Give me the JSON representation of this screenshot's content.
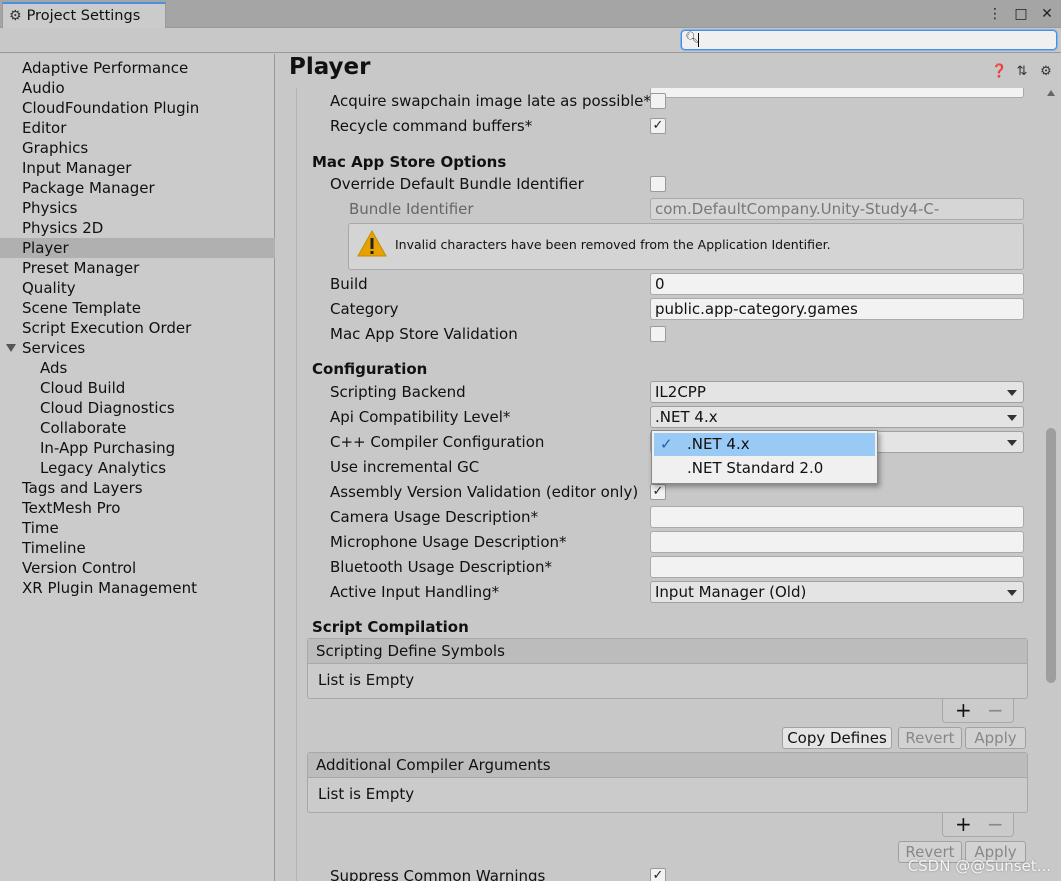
{
  "window": {
    "tab_title": "Project Settings",
    "controls": [
      "⋮",
      "□",
      "✕"
    ]
  },
  "search": {
    "placeholder": "",
    "value": ""
  },
  "sidebar": {
    "items": [
      {
        "label": "Adaptive Performance"
      },
      {
        "label": "Audio"
      },
      {
        "label": "CloudFoundation Plugin"
      },
      {
        "label": "Editor"
      },
      {
        "label": "Graphics"
      },
      {
        "label": "Input Manager"
      },
      {
        "label": "Package Manager"
      },
      {
        "label": "Physics"
      },
      {
        "label": "Physics 2D"
      },
      {
        "label": "Player"
      },
      {
        "label": "Preset Manager"
      },
      {
        "label": "Quality"
      },
      {
        "label": "Scene Template"
      },
      {
        "label": "Script Execution Order"
      },
      {
        "label": "Services"
      },
      {
        "label": "Ads"
      },
      {
        "label": "Cloud Build"
      },
      {
        "label": "Cloud Diagnostics"
      },
      {
        "label": "Collaborate"
      },
      {
        "label": "In-App Purchasing"
      },
      {
        "label": "Legacy Analytics"
      },
      {
        "label": "Tags and Layers"
      },
      {
        "label": "TextMesh Pro"
      },
      {
        "label": "Time"
      },
      {
        "label": "Timeline"
      },
      {
        "label": "Version Control"
      },
      {
        "label": "XR Plugin Management"
      }
    ],
    "selected": "Player"
  },
  "main": {
    "title": "Player",
    "header_icons": [
      "help-icon",
      "preset-icon",
      "settings-icon"
    ],
    "rows": {
      "acquire_swapchain": "Acquire swapchain image late as possible*",
      "recycle_cmd": "Recycle command buffers*",
      "mac_section": "Mac App Store Options",
      "override_bundle": "Override Default Bundle Identifier",
      "bundle_id_label": "Bundle Identifier",
      "bundle_id_value": "com.DefaultCompany.Unity-Study4-C-",
      "warning": "Invalid characters have been removed from the Application Identifier.",
      "build_label": "Build",
      "build_value": "0",
      "category_label": "Category",
      "category_value": "public.app-category.games",
      "mac_validation": "Mac App Store Validation",
      "config_section": "Configuration",
      "scripting_backend_label": "Scripting Backend",
      "scripting_backend_value": "IL2CPP",
      "api_level_label": "Api Compatibility Level*",
      "api_level_value": ".NET 4.x",
      "cpp_config_label": "C++ Compiler Configuration",
      "incremental_gc": "Use incremental GC",
      "assembly_validation": "Assembly Version Validation (editor only)",
      "camera_usage": "Camera Usage Description*",
      "mic_usage": "Microphone Usage Description*",
      "bluetooth_usage": "Bluetooth Usage Description*",
      "input_handling_label": "Active Input Handling*",
      "input_handling_value": "Input Manager (Old)",
      "script_comp_section": "Script Compilation",
      "define_symbols": "Scripting Define Symbols",
      "list_empty_1": "List is Empty",
      "copy_defines": "Copy Defines",
      "revert_1": "Revert",
      "apply_1": "Apply",
      "compiler_args": "Additional Compiler Arguments",
      "list_empty_2": "List is Empty",
      "revert_2": "Revert",
      "apply_2": "Apply",
      "suppress_warnings": "Suppress Common Warnings",
      "plus": "+",
      "minus": "−"
    },
    "checkbox_states": {
      "acquire_swapchain": false,
      "recycle_cmd": true,
      "override_bundle": false,
      "mac_validation": false,
      "assembly_validation": true,
      "suppress_warnings": true
    }
  },
  "popup": {
    "options": [
      ".NET 4.x",
      ".NET Standard 2.0"
    ],
    "selected": ".NET 4.x",
    "check": "✓"
  },
  "watermark": "CSDN @@Sunset..."
}
